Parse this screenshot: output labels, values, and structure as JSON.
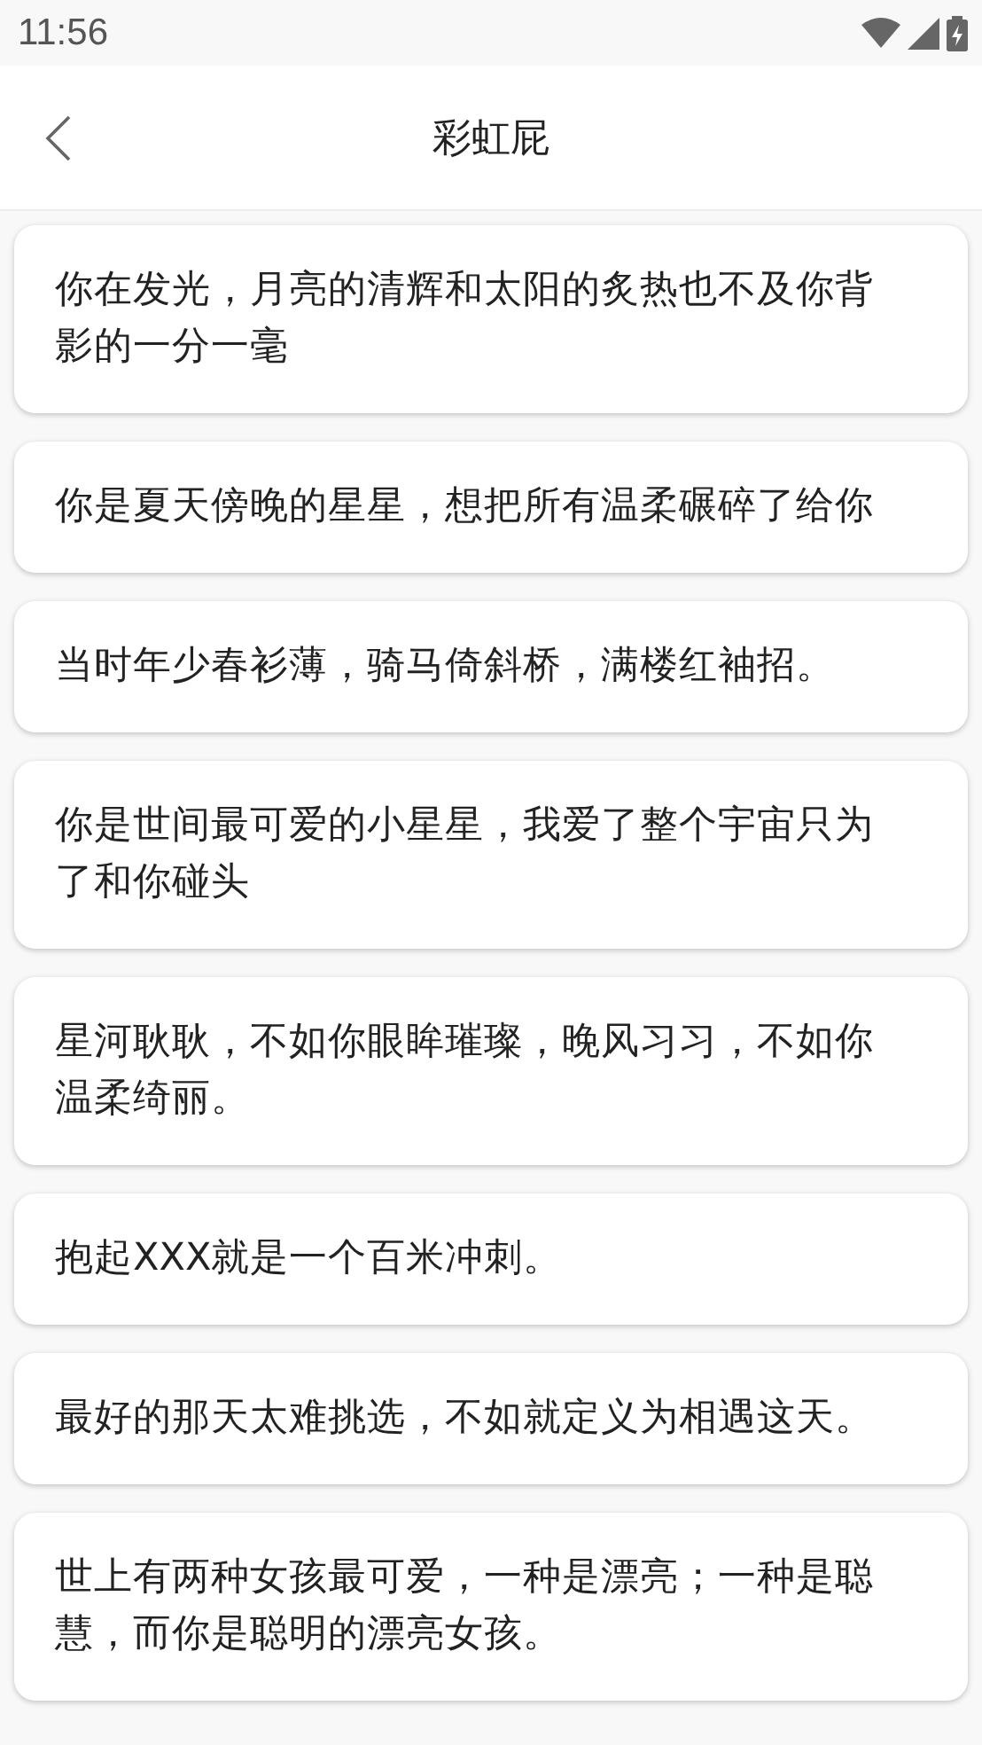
{
  "status_bar": {
    "time": "11:56"
  },
  "header": {
    "title": "彩虹屁"
  },
  "cards": [
    {
      "text": "你在发光，月亮的清辉和太阳的炙热也不及你背影的一分一毫"
    },
    {
      "text": "你是夏天傍晚的星星，想把所有温柔碾碎了给你"
    },
    {
      "text": "当时年少春衫薄，骑马倚斜桥，满楼红袖招。"
    },
    {
      "text": "你是世间最可爱的小星星，我爱了整个宇宙只为了和你碰头"
    },
    {
      "text": "星河耿耿，不如你眼眸璀璨，晚风习习，不如你温柔绮丽。"
    },
    {
      "text": "抱起XXX就是一个百米冲刺。"
    },
    {
      "text": "最好的那天太难挑选，不如就定义为相遇这天。"
    },
    {
      "text": "世上有两种女孩最可爱，一种是漂亮；一种是聪慧，而你是聪明的漂亮女孩。"
    }
  ]
}
